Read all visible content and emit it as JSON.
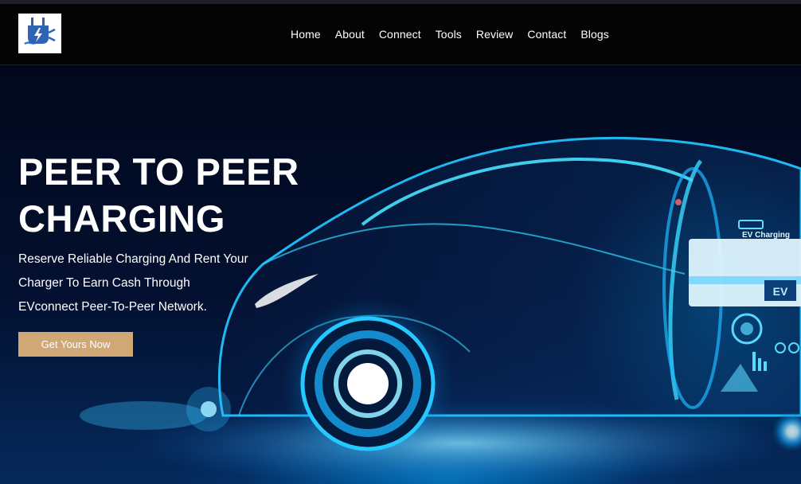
{
  "header": {
    "logo_icon": "plug-lightning-icon",
    "nav": [
      {
        "label": "Home"
      },
      {
        "label": "About"
      },
      {
        "label": "Connect"
      },
      {
        "label": "Tools"
      },
      {
        "label": "Review"
      },
      {
        "label": "Contact"
      },
      {
        "label": "Blogs"
      }
    ]
  },
  "hero": {
    "title_line1": "PEER TO PEER",
    "title_line2": "CHARGING",
    "subtitle_line1": "Reserve Reliable Charging And Rent Your",
    "subtitle_line2": "Charger To Earn Cash Through",
    "subtitle_line3": "EVconnect Peer-To-Peer Network.",
    "cta_label": "Get Yours Now",
    "cta_color": "#cfa876",
    "image": {
      "charger_sign": "EV Charging",
      "charger_badge": "EV"
    }
  }
}
